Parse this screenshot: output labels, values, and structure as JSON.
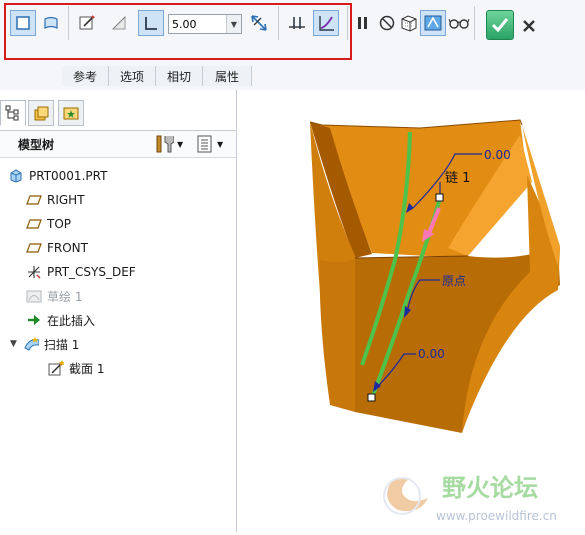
{
  "toolbar": {
    "buttons": [
      {
        "name": "solid-icon",
        "active": true
      },
      {
        "name": "surface-icon",
        "active": false
      },
      {
        "name": "sketch-icon",
        "active": false
      },
      {
        "name": "remove-material-icon",
        "active": false
      },
      {
        "name": "thicken-icon",
        "active": true
      },
      {
        "name": "flip-direction-icon",
        "active": false
      },
      {
        "name": "constant-section-icon",
        "active": false
      },
      {
        "name": "variable-section-icon",
        "active": true
      },
      {
        "name": "pause-icon",
        "active": false
      },
      {
        "name": "no-preview-icon",
        "active": false
      },
      {
        "name": "geometry-preview-icon",
        "active": false
      },
      {
        "name": "verify-mode-icon",
        "active": true
      },
      {
        "name": "glasses-icon",
        "active": false
      },
      {
        "name": "confirm-icon",
        "active": false
      },
      {
        "name": "cancel-icon",
        "active": false
      }
    ],
    "thickness_value": "5.00",
    "tabs": [
      "参考",
      "选项",
      "相切",
      "属性"
    ]
  },
  "nav": {
    "tabs": [
      "model-tree-tab-icon",
      "layer-tree-tab-icon",
      "favorites-tab-icon"
    ],
    "tree_title": "模型树",
    "items": [
      {
        "label": "PRT0001.PRT",
        "icon": "part-icon",
        "indent": 0,
        "dim": false
      },
      {
        "label": "RIGHT",
        "icon": "datum-plane-icon",
        "indent": 1,
        "dim": false
      },
      {
        "label": "TOP",
        "icon": "datum-plane-icon",
        "indent": 1,
        "dim": false
      },
      {
        "label": "FRONT",
        "icon": "datum-plane-icon",
        "indent": 1,
        "dim": false
      },
      {
        "label": "PRT_CSYS_DEF",
        "icon": "csys-icon",
        "indent": 1,
        "dim": false
      },
      {
        "label": "草绘 1",
        "icon": "sketch-feature-icon",
        "indent": 1,
        "dim": true
      },
      {
        "label": "在此插入",
        "icon": "insert-arrow-icon",
        "indent": 1,
        "dim": false
      },
      {
        "label": "扫描 1",
        "icon": "sweep-icon",
        "indent": 1,
        "dim": false
      },
      {
        "label": "截面 1",
        "icon": "section-icon",
        "indent": 2,
        "dim": false
      }
    ]
  },
  "viewport": {
    "dim_top": "0.00",
    "chain_label": "链 1",
    "origin_label": "原点",
    "dim_bottom": "0.00",
    "watermark_name": "野火论坛",
    "watermark_url": "www.proewildfire.cn",
    "colors": {
      "body": "#d4810a",
      "body_dark": "#a85f00",
      "body_light": "#ef9b1d",
      "trajectory": "#4ec24a",
      "annotation": "#1b2a9c",
      "direction_arrow": "#ff77b5"
    }
  }
}
